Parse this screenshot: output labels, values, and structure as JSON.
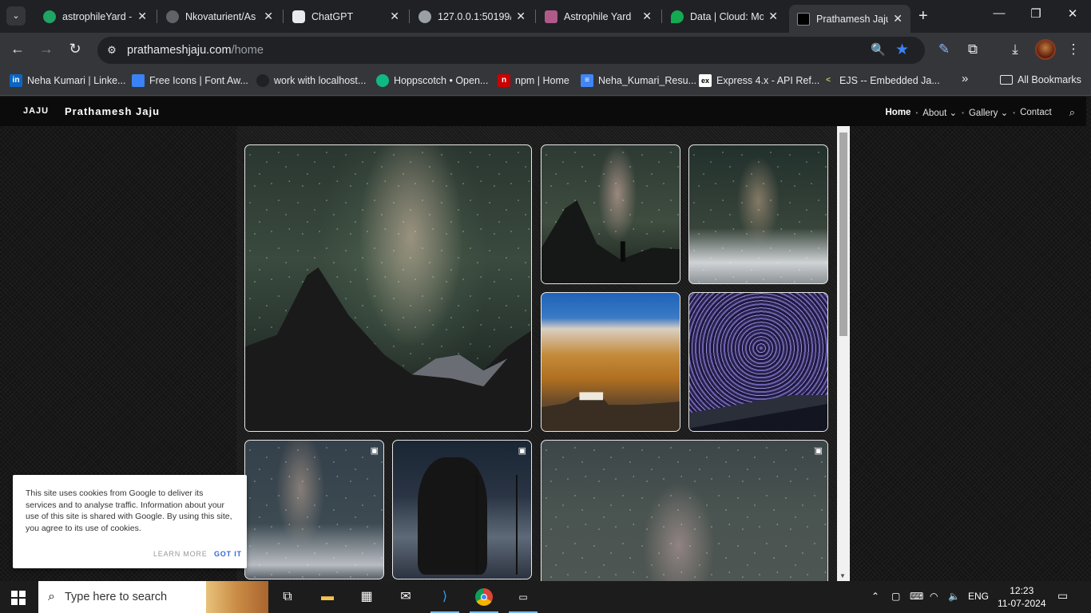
{
  "browser": {
    "tabs": [
      {
        "title": "astrophileYard -",
        "fav": "#1fa463"
      },
      {
        "title": "Nkovaturient/As",
        "fav": "#e8eaed"
      },
      {
        "title": "ChatGPT",
        "fav": "#e8eaed"
      },
      {
        "title": "127.0.0.1:50199/",
        "fav": "#9aa0a6"
      },
      {
        "title": "Astrophile Yard",
        "fav": "#b05a8a"
      },
      {
        "title": "Data | Cloud: Mo",
        "fav": "#13aa52"
      },
      {
        "title": "Prathamesh Jaju",
        "fav": "#ffffff"
      }
    ],
    "url_host": "prathameshjaju.com",
    "url_path": "/home",
    "bookmarks": [
      {
        "label": "Neha Kumari | Linke...",
        "color": "#0a66c2",
        "glyph": "in"
      },
      {
        "label": "Free Icons | Font Aw...",
        "color": "#3b82f6",
        "glyph": "▶"
      },
      {
        "label": "work with localhost...",
        "color": "#202124",
        "glyph": ""
      },
      {
        "label": "Hoppscotch • Open...",
        "color": "#10b981",
        "glyph": "◉"
      },
      {
        "label": "npm | Home",
        "color": "#cb0000",
        "glyph": "n"
      },
      {
        "label": "Neha_Kumari_Resu...",
        "color": "#4285f4",
        "glyph": "≡"
      },
      {
        "label": "Express 4.x - API Ref...",
        "color": "#ffffff",
        "glyph": "ex"
      },
      {
        "label": "EJS -- Embedded Ja...",
        "color": "#b4ca65",
        "glyph": "<"
      }
    ],
    "more_bookmarks": "»",
    "all_bookmarks": "All Bookmarks"
  },
  "site": {
    "logo": "JAJU",
    "name": "Prathamesh Jaju",
    "nav": {
      "home": "Home",
      "about": "About",
      "gallery": "Gallery",
      "contact": "Contact"
    },
    "cookie": {
      "text": "This site uses cookies from Google to deliver its services and to analyse traffic. Information about your use of this site is shared with Google. By using this site, you agree to its use of cookies.",
      "learn_more": "LEARN MORE",
      "got_it": "GOT IT"
    }
  },
  "taskbar": {
    "search_placeholder": "Type here to search",
    "lang": "ENG",
    "time": "12:23",
    "date": "11-07-2024"
  }
}
